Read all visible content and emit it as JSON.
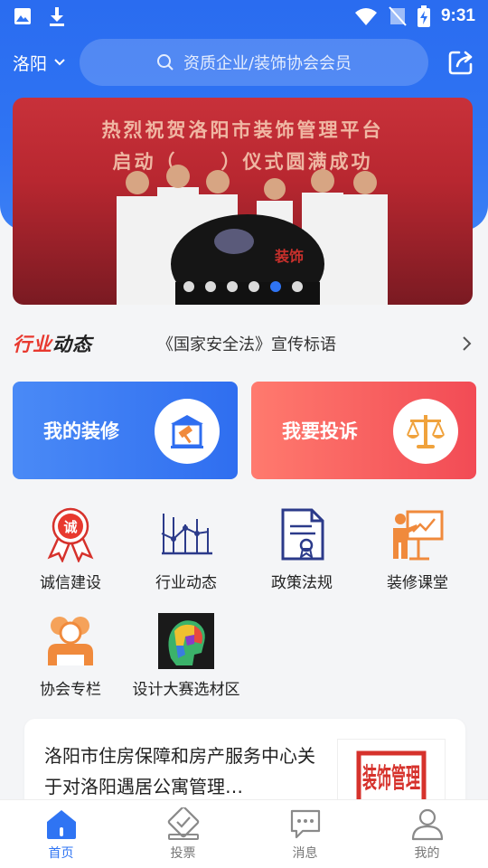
{
  "status_bar": {
    "time": "9:31",
    "icons": [
      "image-icon",
      "download-icon",
      "wifi-icon",
      "no-sim-icon",
      "battery-charging-icon"
    ]
  },
  "topbar": {
    "city": "洛阳",
    "search_placeholder": "资质企业/装饰协会会员"
  },
  "banner": {
    "line1": "热烈祝贺洛阳市装饰管理平台",
    "line2": "启动（　　）仪式圆满成功",
    "dots_count": 6,
    "active_dot": 5
  },
  "news": {
    "label_part1": "行业",
    "label_part2": "动态",
    "headline": "《国家安全法》宣传标语"
  },
  "cards": [
    {
      "label": "我的装修",
      "icon": "house-hammer-icon"
    },
    {
      "label": "我要投诉",
      "icon": "scales-icon"
    }
  ],
  "grid": [
    {
      "label": "诚信建设",
      "icon": "integrity-ribbon-icon",
      "badge": "诚"
    },
    {
      "label": "行业动态",
      "icon": "line-chart-icon"
    },
    {
      "label": "政策法规",
      "icon": "document-seal-icon"
    },
    {
      "label": "装修课堂",
      "icon": "classroom-icon"
    },
    {
      "label": "协会专栏",
      "icon": "association-icon"
    },
    {
      "label": "设计大赛选材区",
      "icon": "design-contest-icon"
    }
  ],
  "article": {
    "title": "洛阳市住房保障和房产服务中心关于对洛阳遇居公寓管理…",
    "thumb_text": "装饰管理"
  },
  "bottom_nav": [
    {
      "label": "首页",
      "icon": "home-icon",
      "active": true
    },
    {
      "label": "投票",
      "icon": "vote-icon",
      "active": false
    },
    {
      "label": "消息",
      "icon": "message-icon",
      "active": false
    },
    {
      "label": "我的",
      "icon": "profile-icon",
      "active": false
    }
  ],
  "colors": {
    "primary_blue": "#2f74f3",
    "complaint_red": "#f24b55",
    "accent_orange": "#f08a3c",
    "accent_red": "#e8392f",
    "navy": "#2b3a8a"
  }
}
